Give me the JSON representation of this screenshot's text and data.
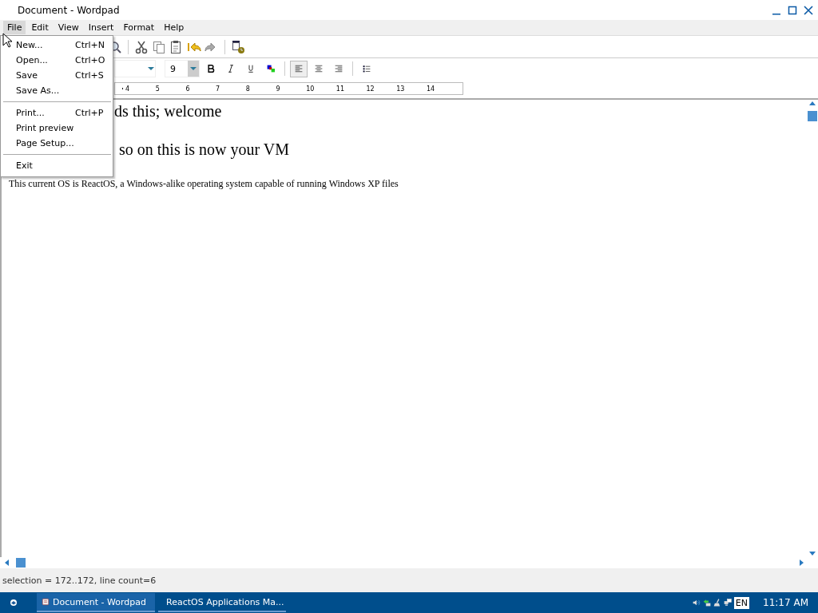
{
  "window": {
    "title": "Document - Wordpad"
  },
  "menu_bar": [
    {
      "label": "File",
      "selected": true
    },
    {
      "label": "Edit",
      "selected": false
    },
    {
      "label": "View",
      "selected": false
    },
    {
      "label": "Insert",
      "selected": false
    },
    {
      "label": "Format",
      "selected": false
    },
    {
      "label": "Help",
      "selected": false
    }
  ],
  "file_menu": [
    {
      "kind": "item",
      "label": "New...",
      "shortcut": "Ctrl+N"
    },
    {
      "kind": "item",
      "label": "Open...",
      "shortcut": "Ctrl+O"
    },
    {
      "kind": "item",
      "label": "Save",
      "shortcut": "Ctrl+S"
    },
    {
      "kind": "item",
      "label": "Save As..."
    },
    {
      "kind": "separator"
    },
    {
      "kind": "item",
      "label": "Print...",
      "shortcut": "Ctrl+P"
    },
    {
      "kind": "item",
      "label": "Print preview"
    },
    {
      "kind": "item",
      "label": "Page Setup..."
    },
    {
      "kind": "separator"
    },
    {
      "kind": "item",
      "label": "Exit"
    }
  ],
  "format_bar": {
    "font_size": "9",
    "alignment": [
      {
        "kind": "left",
        "selected": true
      },
      {
        "kind": "center",
        "selected": false
      },
      {
        "kind": "right",
        "selected": false
      }
    ]
  },
  "ruler": {
    "numbers": [
      "4",
      "5",
      "6",
      "7",
      "8",
      "9",
      "10",
      "11",
      "12",
      "13",
      "14"
    ]
  },
  "document": {
    "lines": [
      {
        "kind": "large",
        "text": "ds this; welcome"
      },
      {
        "kind": "large",
        "text": "so on this is now your VM"
      },
      {
        "kind": "small",
        "text": "This current OS is ReactOS, a Windows-alike operating system capable of running Windows XP files"
      }
    ]
  },
  "status_bar": "selection = 172..172, line count=6",
  "taskbar": {
    "tasks": [
      {
        "label": "Document - Wordpad",
        "selected": true,
        "kind": "wordpad"
      },
      {
        "label": "ReactOS Applications Ma...",
        "selected": false,
        "kind": "apps"
      }
    ],
    "language": "EN",
    "clock": "11:17 AM"
  }
}
